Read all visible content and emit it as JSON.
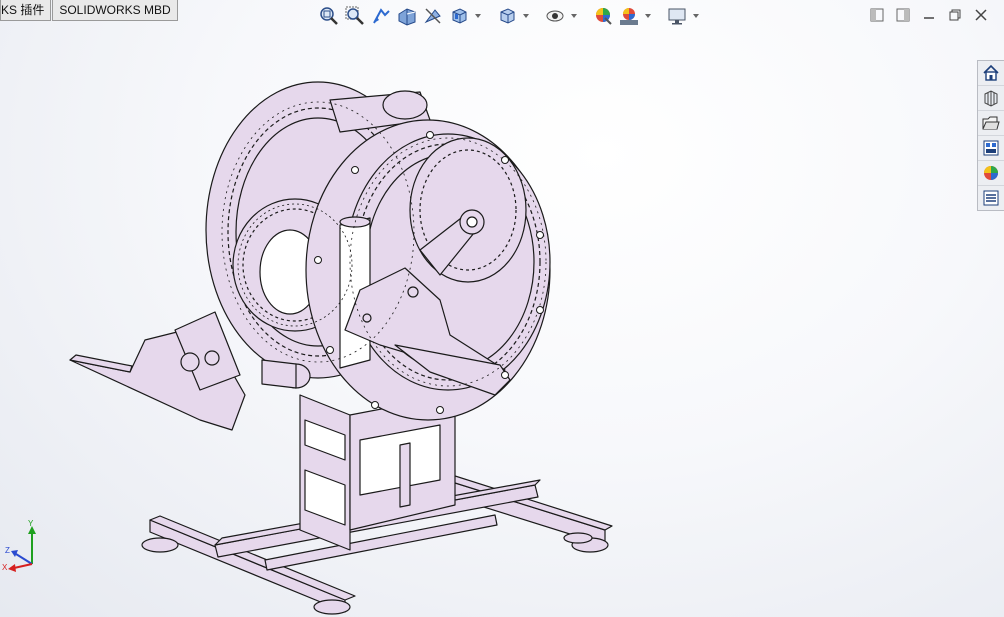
{
  "tabs": [
    {
      "label": "KS 插件"
    },
    {
      "label": "SOLIDWORKS MBD"
    }
  ],
  "heads_up_toolbar": [
    {
      "icon": "zoom-to-fit-icon"
    },
    {
      "icon": "zoom-to-area-icon"
    },
    {
      "icon": "previous-view-icon"
    },
    {
      "icon": "section-view-icon"
    },
    {
      "icon": "dynamic-annotation-views-icon"
    },
    {
      "icon": "view-orientation-icon",
      "dropdown": true
    },
    {
      "icon": "display-style-icon",
      "dropdown": true
    },
    {
      "icon": "hide-show-items-icon",
      "dropdown": true
    },
    {
      "icon": "edit-appearance-icon"
    },
    {
      "icon": "apply-scene-icon",
      "dropdown": true
    },
    {
      "icon": "view-settings-icon",
      "dropdown": true
    }
  ],
  "window_controls": [
    {
      "icon": "tile-left-icon"
    },
    {
      "icon": "tile-right-icon"
    },
    {
      "icon": "minimize-icon"
    },
    {
      "icon": "restore-icon"
    },
    {
      "icon": "close-icon"
    }
  ],
  "task_pane": [
    {
      "icon": "solidworks-resources-icon"
    },
    {
      "icon": "design-library-icon"
    },
    {
      "icon": "file-explorer-icon"
    },
    {
      "icon": "view-palette-icon"
    },
    {
      "icon": "appearances-scenes-icon"
    },
    {
      "icon": "custom-properties-icon"
    }
  ],
  "triad": {
    "y": "Y",
    "z": "Z",
    "x": "X"
  },
  "colors": {
    "part_fill": "#e6d8ec",
    "edge": "#1a1a1a",
    "axis_x": "#d62020",
    "axis_y": "#1fa01f",
    "axis_z": "#2a4ad0"
  }
}
